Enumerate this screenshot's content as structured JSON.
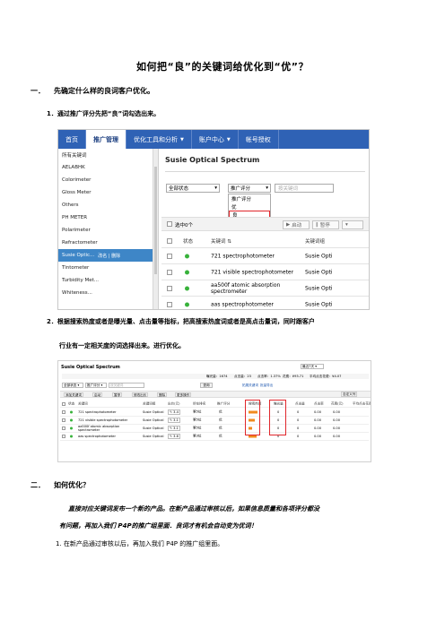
{
  "doc": {
    "title": "如何把“良”的关键词给优化到“优”？",
    "section1": {
      "num": "一．",
      "heading": "先确定什么样的良词客户优化。"
    },
    "step1": "1．通过推广评分先把“良”词勾选出来。",
    "step2_line1": "2．根据搜索热度或者是曝光量、点击量等指标，把高搜索热度词或者是高点击量词，同时跟客户",
    "step2_line2": "行业有一定相关度的词选择出来。进行优化。",
    "section2": {
      "num": "二．",
      "heading": "如何优化？"
    },
    "italic_line1": "直接对应关键词发布一个新的产品。在新产品通过审核以后，如果信息质量和各项评分都没",
    "italic_line2": "有问题，再加入我们 P4P的推广组里面．良词才有机会自动变为优词！",
    "step_b1": "1.   在新产品通过审核以后，再加入我们 P4P 的推广组里面。"
  },
  "shot1": {
    "nav": [
      {
        "label": "首页",
        "caret": false,
        "active": false
      },
      {
        "label": "推广管理",
        "caret": false,
        "active": true
      },
      {
        "label": "优化工具和分析",
        "caret": true,
        "active": false
      },
      {
        "label": "账户中心",
        "caret": true,
        "active": false
      },
      {
        "label": "帐号授权",
        "caret": false,
        "active": false
      }
    ],
    "sidebar": [
      "所有关键词",
      "AELABHK",
      "Colorimeter",
      "Gloss Meter",
      "Others",
      "PH METER",
      "Polarimeter",
      "Refractometer",
      "Susie Optic...",
      "Tintometer",
      "Turbidity Met...",
      "Whiteness..."
    ],
    "sidebar_active_tail": "改名 | 删除",
    "group_title": "Susie Optical Spectrum",
    "filter_status": "全部状态",
    "filter_score": "推广评分",
    "keyword_search_placeholder": "按关键词",
    "dropdown_options": [
      "推广评分",
      "优",
      "良",
      "-"
    ],
    "select_label": "选中0个",
    "buttons": {
      "start": "启动",
      "pause": "暂停",
      "more": ""
    },
    "table_headers": {
      "status": "状态",
      "keyword": "关键词",
      "group": "关键词组"
    },
    "rows": [
      {
        "keyword": "721 spectrophotometer",
        "group": "Susie Opti"
      },
      {
        "keyword": "721 visible spectrophotometer",
        "group": "Susie Opti"
      },
      {
        "keyword": "aa500f atomic absorption spectrometer",
        "group": "Susie Opti"
      },
      {
        "keyword": "aas spectrophotometer",
        "group": "Susie Opti"
      }
    ]
  },
  "shot2": {
    "title": "Susie Optical Spectrum",
    "date_range": "最近7天",
    "summary": [
      "曝光量：1674",
      "点击量：23",
      "点击率：1.37%",
      "花费：¥93.71",
      "平均点击花费：¥4.07"
    ],
    "filter_status": "全部状态",
    "filter_score": "推广评分",
    "search_placeholder": "按关键词",
    "search_button": "查询",
    "links": [
      "拓展关键词",
      "批量导出"
    ],
    "toolbar": [
      "添加关键词",
      "启动",
      "暂停",
      "修改出价",
      "删除",
      "更多操作"
    ],
    "custom_columns": "自定义列",
    "headers": [
      "状态",
      "关键词",
      "关键词组",
      "出价(元)",
      "所在排名",
      "推广评分",
      "搜索热度",
      "曝光量",
      "点击量",
      "点击率",
      "花费(元)",
      "平均点击花费(元)"
    ],
    "rows": [
      {
        "keyword": "721 spectrophotometer",
        "group": "Susie Optical",
        "bid": "3.4",
        "rank": "第5位",
        "score": "优",
        "heat": "0.83",
        "impr": "0",
        "clicks": "0",
        "ctr": "0.00",
        "cost": "0.00"
      },
      {
        "keyword": "721 visible spectrophotometer",
        "group": "Susie Optical",
        "bid": "3.1",
        "rank": "第5位",
        "score": "优",
        "heat": "0.56",
        "impr": "0",
        "clicks": "0",
        "ctr": "0.00",
        "cost": "0.00"
      },
      {
        "keyword": "aa500f atomic absorption spectrometer",
        "group": "Susie Optical",
        "bid": "3.1",
        "rank": "第5位",
        "score": "优",
        "heat": "0.30",
        "impr": "0",
        "clicks": "0",
        "ctr": "0.00",
        "cost": "0.00"
      },
      {
        "keyword": "aas spectrophotometer",
        "group": "Susie Optical",
        "bid": "3.6",
        "rank": "第3位",
        "score": "优",
        "heat": "0.78",
        "impr": "0",
        "clicks": "0",
        "ctr": "0.00",
        "cost": "0.00"
      }
    ]
  },
  "colors": {
    "nav_blue": "#2f62b5",
    "active_side": "#3e86c7",
    "highlight_red": "#e0262b",
    "status_green": "#38b23b"
  }
}
